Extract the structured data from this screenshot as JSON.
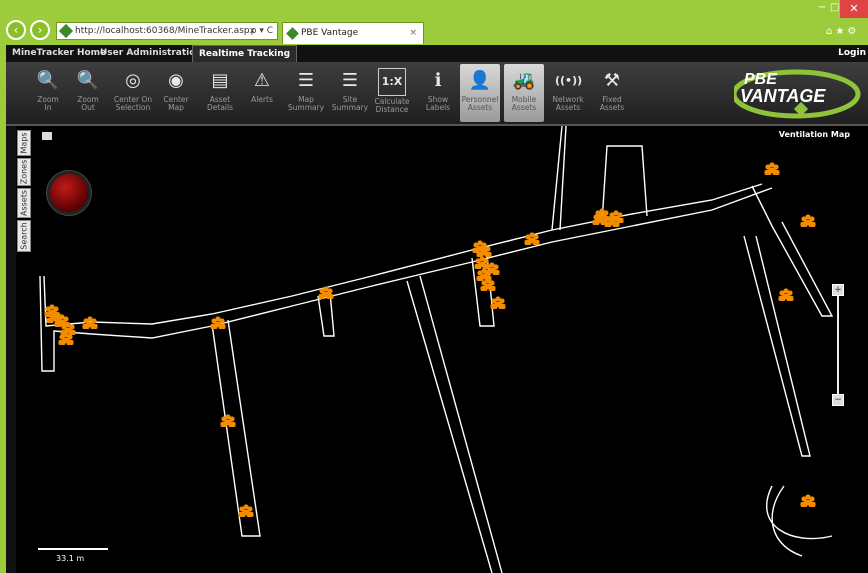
{
  "browser": {
    "url": "http://localhost:60368/MineTracker.aspx",
    "addr_ctrls": "ρ ▾ C",
    "tab_title": "PBE Vantage",
    "tab_close": "×",
    "min": "−",
    "max": "□",
    "close": "✕",
    "right_icons": "⌂★⚙"
  },
  "app": {
    "tabs": [
      {
        "label": "MineTracker Home"
      },
      {
        "label": "User Administration"
      },
      {
        "label": "Realtime Tracking"
      }
    ],
    "login": "Login"
  },
  "toolbar": {
    "tools": [
      {
        "icon": "🔍",
        "label1": "Zoom",
        "label2": "In"
      },
      {
        "icon": "🔍",
        "label1": "Zoom",
        "label2": "Out"
      },
      {
        "icon": "◎",
        "label1": "Center On",
        "label2": "Selection"
      },
      {
        "icon": "◉",
        "label1": "Center",
        "label2": "Map"
      },
      {
        "icon": "▤",
        "label1": "Asset",
        "label2": "Details"
      },
      {
        "icon": "⚠",
        "label1": "Alerts",
        "label2": ""
      },
      {
        "icon": "☰",
        "label1": "Map",
        "label2": "Summary"
      },
      {
        "icon": "☰",
        "label1": "Site",
        "label2": "Summary"
      },
      {
        "icon": "1:X",
        "label1": "Calculate",
        "label2": "Distance"
      },
      {
        "icon": "ℹ",
        "label1": "Show",
        "label2": "Labels"
      },
      {
        "icon": "👤",
        "label1": "Personnel",
        "label2": "Assets"
      },
      {
        "icon": "🚜",
        "label1": "Mobile",
        "label2": "Assets"
      },
      {
        "icon": "((•))",
        "label1": "Network",
        "label2": "Assets"
      },
      {
        "icon": "⚒",
        "label1": "Fixed",
        "label2": "Assets"
      }
    ],
    "logo_top": "PBE",
    "logo_bottom": "VANTAGE"
  },
  "side_tabs": [
    "Maps",
    "Zones",
    "Assets",
    "Search"
  ],
  "map": {
    "title": "Ventilation Map",
    "scale_label": "33.1 m",
    "zoom_in": "+",
    "zoom_out": "−",
    "personnel_count": 26,
    "colors": {
      "tunnel": "#ffffff",
      "personnel": "#f28c00",
      "alarm": "#b00000"
    }
  }
}
